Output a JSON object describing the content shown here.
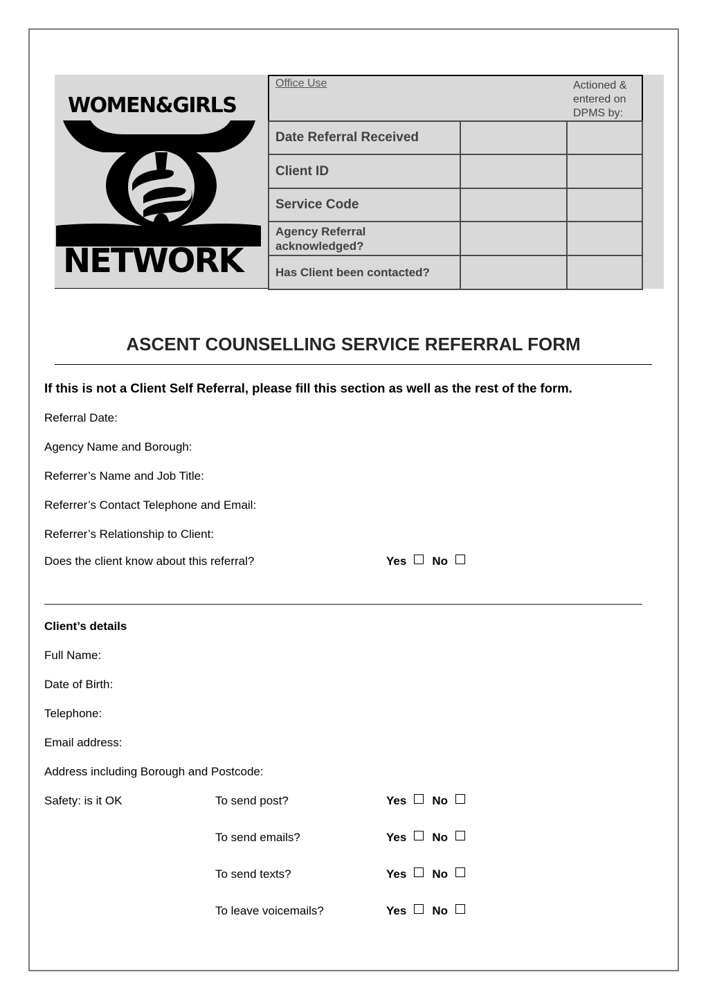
{
  "logo": {
    "line1": "WOMEN&GIRLS",
    "line2": "NETWORK"
  },
  "office_table": {
    "header_label": "Office Use",
    "actioned_label": "Actioned & entered on DPMS by:",
    "rows": [
      {
        "label": "Date Referral Received",
        "value": "",
        "actioned_by": ""
      },
      {
        "label": "Client ID",
        "value": "",
        "actioned_by": ""
      },
      {
        "label": "Service Code",
        "value": "",
        "actioned_by": ""
      },
      {
        "label": "Agency Referral acknowledged?",
        "value": "",
        "actioned_by": ""
      },
      {
        "label": "Has Client been contacted?",
        "value": "",
        "actioned_by": ""
      }
    ]
  },
  "form": {
    "title": "ASCENT COUNSELLING SERVICE REFERRAL FORM",
    "instruction": "If this is not a Client Self Referral, please fill this section as well as the rest of the form.",
    "referral_fields": [
      "Referral Date:",
      "Agency Name and Borough:",
      "Referrer’s Name and Job Title:",
      "Referrer’s Contact Telephone and Email:",
      "Referrer’s Relationship to Client:"
    ],
    "client_knows_question": "Does the client know about this referral?",
    "yes_label": "Yes",
    "no_label": "No",
    "client_section_heading": "Client’s details",
    "client_fields": [
      "Full Name:",
      "Date of Birth:",
      "Telephone:",
      "Email address:",
      "Address including Borough and Postcode:"
    ],
    "safety_label": "Safety: is it OK",
    "safety_questions": [
      "To send post?",
      "To send emails?",
      "To send texts?",
      "To leave voicemails?"
    ]
  }
}
